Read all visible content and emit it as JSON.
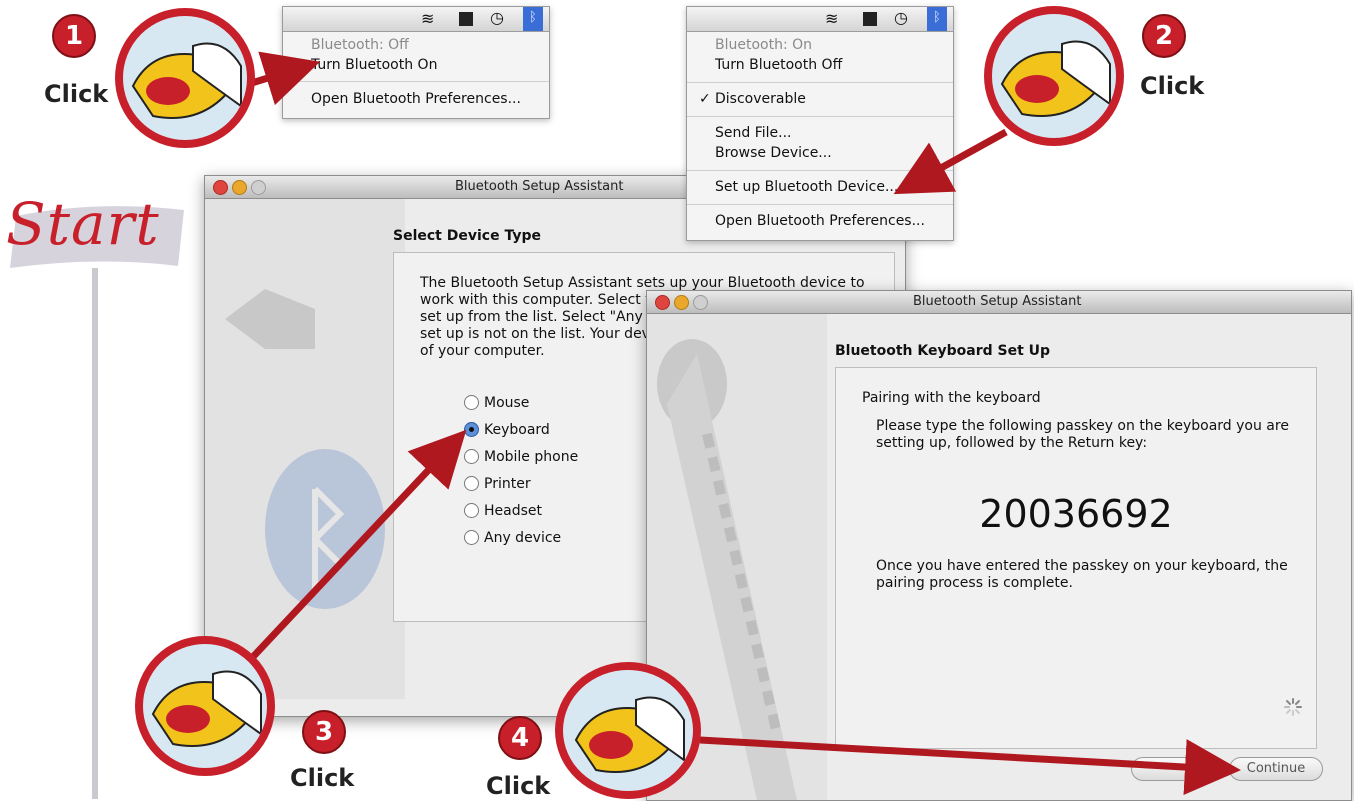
{
  "banner": {
    "start_label": "Start"
  },
  "steps": [
    {
      "number": "1",
      "click_label": "Click"
    },
    {
      "number": "2",
      "click_label": "Click"
    },
    {
      "number": "3",
      "click_label": "Click"
    },
    {
      "number": "4",
      "click_label": "Click"
    }
  ],
  "menu1": {
    "items": [
      "Bluetooth: Off",
      "Turn Bluetooth On",
      "Open Bluetooth Preferences..."
    ],
    "status_icons": [
      "wifi-icon",
      "flag-icon",
      "time-machine-icon",
      "bluetooth-icon"
    ]
  },
  "menu2": {
    "items": [
      "Bluetooth: On",
      "Turn Bluetooth Off",
      "Discoverable",
      "Send File...",
      "Browse Device...",
      "Set up Bluetooth Device...",
      "Open Bluetooth Preferences..."
    ],
    "checkmark": "✓",
    "status_icons": [
      "wifi-icon",
      "flag-icon",
      "time-machine-icon",
      "bluetooth-icon"
    ]
  },
  "window1": {
    "title": "Bluetooth Setup Assistant",
    "heading": "Select Device Type",
    "intro_lines": [
      "The Bluetooth Setup Assistant sets up your Bluetooth device to",
      "work with this computer. Select th",
      "set up from the list. Select \"Any d",
      "set up is not on the list. Your dev",
      "of your computer."
    ],
    "options": [
      "Mouse",
      "Keyboard",
      "Mobile phone",
      "Printer",
      "Headset",
      "Any device"
    ],
    "selected": "Keyboard"
  },
  "window2": {
    "title": "Bluetooth Setup Assistant",
    "heading": "Bluetooth Keyboard Set Up",
    "subheading": "Pairing with the keyboard",
    "instruction_lines": [
      "Please type the following passkey on the keyboard you are",
      "setting up, followed by the Return key:"
    ],
    "passkey": "20036692",
    "after_lines": [
      "Once you have entered the passkey on your keyboard, the",
      "pairing process is complete."
    ],
    "continue_label": "Continue"
  },
  "colors": {
    "accent_red": "#c8202b",
    "selection_blue": "#3b6dd6"
  }
}
